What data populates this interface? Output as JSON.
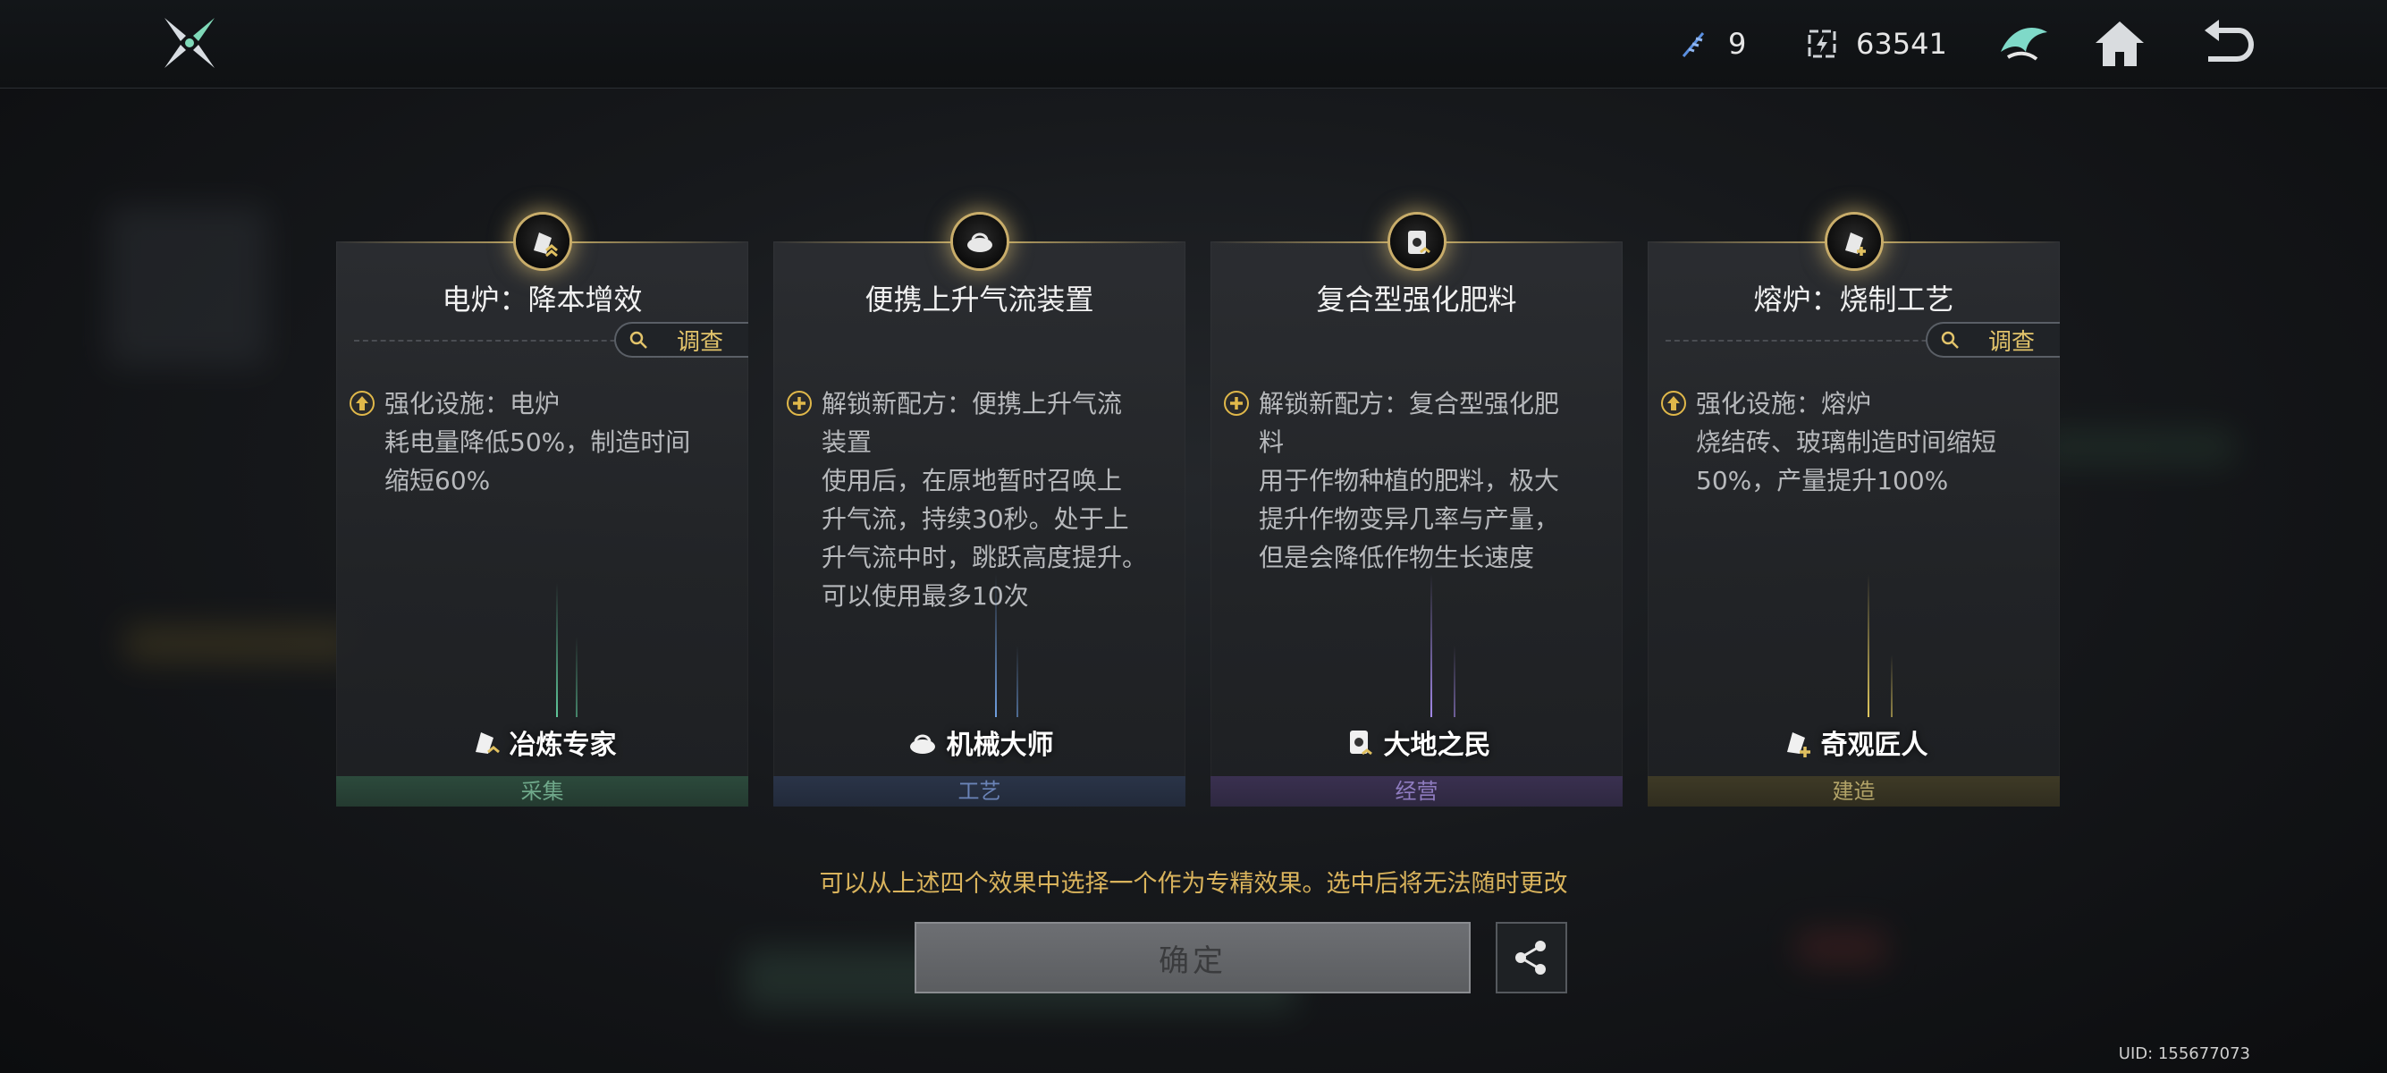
{
  "topbar": {
    "resource_a": "9",
    "resource_b": "63541"
  },
  "cards": [
    {
      "title": "电炉：降本增效",
      "inspect_label": "调查",
      "bullet": "upgrade",
      "lines": [
        "强化设施：电炉",
        "耗电量降低50%，制造时间",
        "缩短60%"
      ],
      "role": "冶炼专家",
      "category": "采集",
      "accent": "#5fc79a"
    },
    {
      "title": "便携上升气流装置",
      "bullet": "unlock",
      "lines": [
        "解锁新配方：便携上升气流",
        "装置",
        "使用后，在原地暂时召唤上",
        "升气流，持续30秒。处于上",
        "升气流中时，跳跃高度提升。",
        "可以使用最多10次"
      ],
      "role": "机械大师",
      "category": "工艺",
      "accent": "#6f9fe0"
    },
    {
      "title": "复合型强化肥料",
      "bullet": "unlock",
      "lines": [
        "解锁新配方：复合型强化肥",
        "料",
        "用于作物种植的肥料，极大",
        "提升作物变异几率与产量，",
        "但是会降低作物生长速度"
      ],
      "role": "大地之民",
      "category": "经营",
      "accent": "#a389e8"
    },
    {
      "title": "熔炉：烧制工艺",
      "inspect_label": "调查",
      "bullet": "upgrade",
      "lines": [
        "强化设施：熔炉",
        "烧结砖、玻璃制造时间缩短",
        "50%，产量提升100%"
      ],
      "role": "奇观匠人",
      "category": "建造",
      "accent": "#e0c85f"
    }
  ],
  "hint": "可以从上述四个效果中选择一个作为专精效果。选中后将无法随时更改",
  "confirm_label": "确定",
  "uid": "UID: 155677073",
  "colors": {
    "gold": "#d9b35c",
    "card_bg": "#2b2d31"
  }
}
